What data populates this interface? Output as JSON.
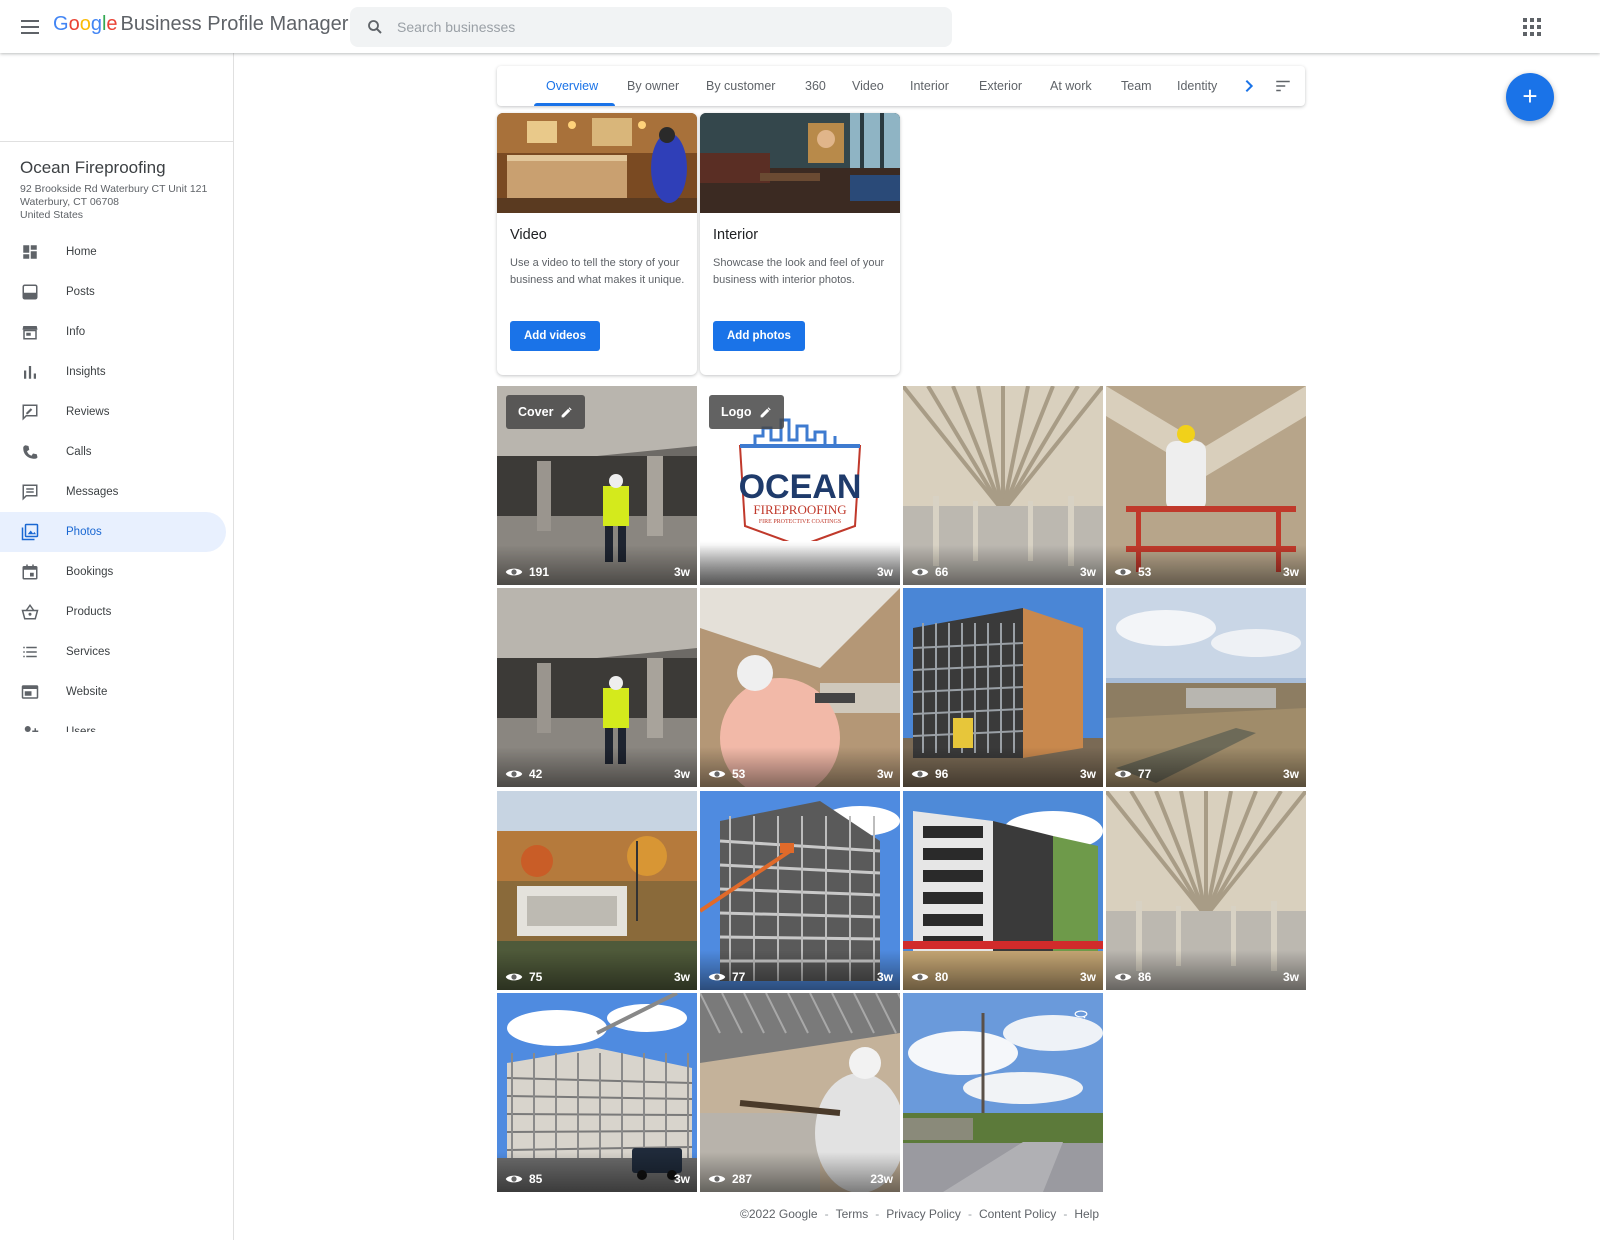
{
  "app": {
    "brand_letters": [
      "G",
      "o",
      "o",
      "g",
      "l",
      "e"
    ],
    "brand_rest": "Business Profile Manager"
  },
  "search": {
    "placeholder": "Search businesses",
    "value": ""
  },
  "business": {
    "name": "Ocean Fireproofing",
    "address_lines": [
      "92 Brookside Rd Waterbury CT Unit 121",
      "Waterbury, CT 06708",
      "United States"
    ]
  },
  "sidebar": {
    "items": [
      {
        "label": "Home",
        "icon": "dashboard-icon"
      },
      {
        "label": "Posts",
        "icon": "posts-icon"
      },
      {
        "label": "Info",
        "icon": "storefront-icon"
      },
      {
        "label": "Insights",
        "icon": "bar-chart-icon"
      },
      {
        "label": "Reviews",
        "icon": "rate-review-icon"
      },
      {
        "label": "Calls",
        "icon": "phone-icon"
      },
      {
        "label": "Messages",
        "icon": "message-icon"
      },
      {
        "label": "Photos",
        "icon": "photo-library-icon",
        "active": true
      },
      {
        "label": "Bookings",
        "icon": "calendar-icon"
      },
      {
        "label": "Products",
        "icon": "shopping-basket-icon"
      },
      {
        "label": "Services",
        "icon": "list-icon"
      },
      {
        "label": "Website",
        "icon": "web-icon"
      },
      {
        "label": "Users",
        "icon": "person-add-icon"
      }
    ]
  },
  "tabs": {
    "items": [
      "Overview",
      "By owner",
      "By customer",
      "360",
      "Video",
      "Interior",
      "Exterior",
      "At work",
      "Team",
      "Identity"
    ],
    "active": "Overview"
  },
  "cards": [
    {
      "title": "Video",
      "description": "Use a video to tell the story of your business and what makes it unique.",
      "button": "Add videos"
    },
    {
      "title": "Interior",
      "description": "Showcase the look and feel of your business with interior photos.",
      "button": "Add photos"
    }
  ],
  "photos": {
    "items": [
      {
        "tag": "Cover",
        "views": "191",
        "age": "3w",
        "scene": "garage-worker"
      },
      {
        "tag": "Logo",
        "views": "",
        "age": "3w",
        "scene": "logo"
      },
      {
        "tag": "",
        "views": "66",
        "age": "3w",
        "scene": "ceiling"
      },
      {
        "tag": "",
        "views": "53",
        "age": "3w",
        "scene": "lift-worker"
      },
      {
        "tag": "",
        "views": "42",
        "age": "3w",
        "scene": "garage-worker"
      },
      {
        "tag": "",
        "views": "53",
        "age": "3w",
        "scene": "spray-worker"
      },
      {
        "tag": "",
        "views": "96",
        "age": "3w",
        "scene": "building-frame"
      },
      {
        "tag": "",
        "views": "77",
        "age": "3w",
        "scene": "site-aerial"
      },
      {
        "tag": "",
        "views": "75",
        "age": "3w",
        "scene": "aerial-autumn"
      },
      {
        "tag": "",
        "views": "77",
        "age": "3w",
        "scene": "steel-frame"
      },
      {
        "tag": "",
        "views": "80",
        "age": "3w",
        "scene": "apartment"
      },
      {
        "tag": "",
        "views": "86",
        "age": "3w",
        "scene": "ceiling"
      },
      {
        "tag": "",
        "views": "85",
        "age": "3w",
        "scene": "steel-frame-crane"
      },
      {
        "tag": "",
        "views": "287",
        "age": "23w",
        "scene": "spray-wall"
      },
      {
        "tag": "",
        "views": "",
        "age": "",
        "scene": "street-view"
      }
    ]
  },
  "logo_text": {
    "main": "OCEAN",
    "sub": "FIREPROOFING",
    "tagline": "FIRE PROTECTIVE COATINGS"
  },
  "footer": [
    "©2022 Google",
    "Terms",
    "Privacy Policy",
    "Content Policy",
    "Help"
  ],
  "colors": {
    "accent": "#1a73e8",
    "active_bg": "#e8f0fe"
  }
}
